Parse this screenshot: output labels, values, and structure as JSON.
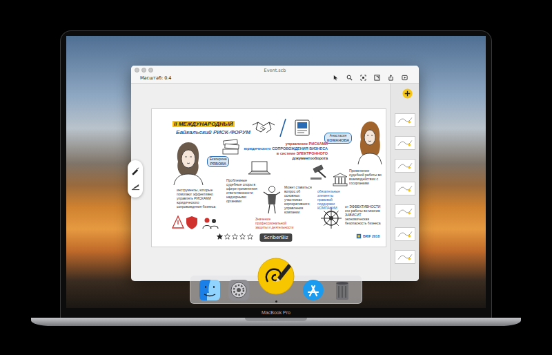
{
  "device": {
    "label": "MacBook Pro"
  },
  "window": {
    "title": "Event.scb",
    "zoom_label": "Масштаб: 0.4"
  },
  "slide": {
    "title": "II МЕЖДУНАРОДНЫЙ",
    "subtitle": "Байкальский РИСК-ФОРУМ",
    "speakers": [
      {
        "first_name": "Екатерина",
        "last_name": "РЯБОВА"
      },
      {
        "first_name": "Анастасия",
        "last_name": "КОМАНОВА"
      }
    ],
    "topic": [
      "управление РИСКАМИ",
      "юридического СОПРОВОЖДЕНИЯ БИЗНЕСА",
      "в системе ЭЛЕКТРОННОГО",
      "документооборота"
    ],
    "notes": [
      "инструменты, которые помогают эффективно управлять РИСКАМИ юридического сопровождения бизнеса",
      "Проблемные судебные споры в сфере применения ответственности надзорными органами",
      "Может ставиться вопрос об основных участниках корпоративного управления компании",
      "Применение судебной работы во взаимодействии с госорганами",
      "обязательные элементы правовой поддержки КОМПАНИИ",
      "от ЭФФЕКТИВНОСТИ его работы во многом ЗАВИСИТ экономическая безопасность бизнеса",
      "Значение профессиональной защиты и деятельности"
    ],
    "rating": {
      "stars": 1,
      "max": 5
    },
    "badge": "BRIF 2018"
  },
  "thumbnails": [
    {
      "selected": false
    },
    {
      "selected": false
    },
    {
      "selected": false
    },
    {
      "selected": false
    },
    {
      "selected": false
    },
    {
      "selected": false
    },
    {
      "selected": false
    }
  ],
  "dock": [
    {
      "kind": "finder",
      "running": false,
      "hovered": false
    },
    {
      "kind": "settings",
      "running": false,
      "hovered": false
    },
    {
      "kind": "scriberbiz",
      "running": true,
      "hovered": true,
      "tooltip": "ScriberBiz"
    },
    {
      "kind": "appstore",
      "running": false,
      "hovered": false
    },
    {
      "kind": "trash",
      "running": false,
      "hovered": false
    }
  ]
}
